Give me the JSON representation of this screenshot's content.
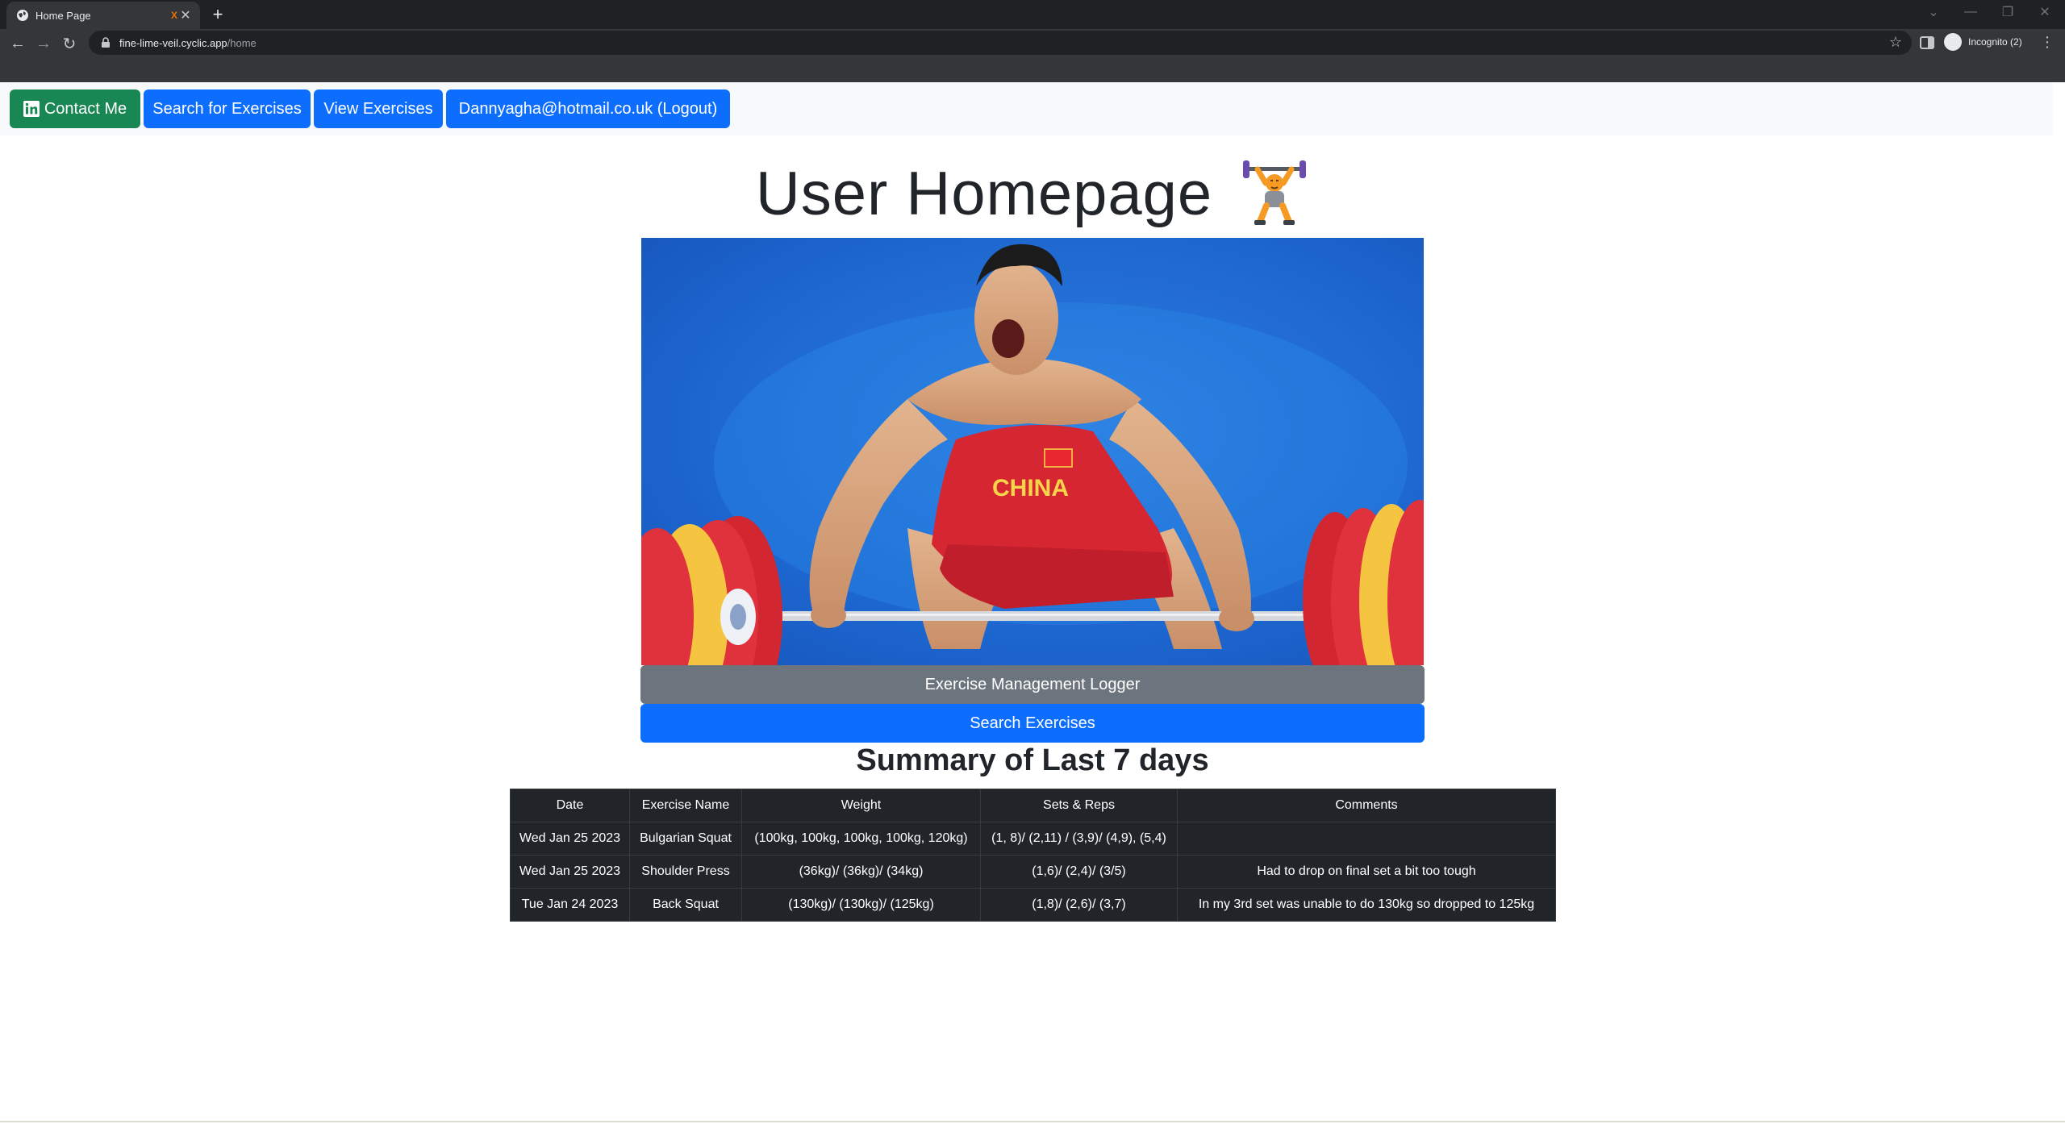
{
  "browser": {
    "tab_title": "Home Page",
    "tab_badge": "X",
    "url_host": "fine-lime-veil.cyclic.app",
    "url_path": "/home",
    "incognito_label": "Incognito (2)"
  },
  "navbar": {
    "contact": "Contact Me",
    "search": "Search for Exercises",
    "view": "View Exercises",
    "logout": "Dannyagha@hotmail.co.uk (Logout)"
  },
  "page": {
    "title": "User Homepage",
    "logger_button": "Exercise Management Logger",
    "search_button": "Search Exercises",
    "summary_title": "Summary of Last 7 days"
  },
  "table": {
    "headers": [
      "Date",
      "Exercise Name",
      "Weight",
      "Sets & Reps",
      "Comments"
    ],
    "rows": [
      [
        "Wed Jan 25 2023",
        "Bulgarian Squat",
        "(100kg, 100kg, 100kg, 100kg, 120kg)",
        "(1, 8)/ (2,11) / (3,9)/ (4,9), (5,4)",
        ""
      ],
      [
        "Wed Jan 25 2023",
        "Shoulder Press",
        "(36kg)/ (36kg)/ (34kg)",
        "(1,6)/ (2,4)/ (3/5)",
        "Had to drop on final set a bit too tough"
      ],
      [
        "Tue Jan 24 2023",
        "Back Squat",
        "(130kg)/ (130kg)/ (125kg)",
        "(1,8)/ (2,6)/ (3,7)",
        "In my 3rd set was unable to do 130kg so dropped to 125kg"
      ]
    ]
  },
  "colors": {
    "primary": "#0d6efd",
    "success": "#198754",
    "secondary": "#6c757d",
    "table_dark": "#212529"
  },
  "icons": {
    "tab_favicon": "globe-icon",
    "contact": "linkedin-icon",
    "heading_emoji": "weightlifter-icon",
    "hero_image": "weightlifter-photo"
  }
}
